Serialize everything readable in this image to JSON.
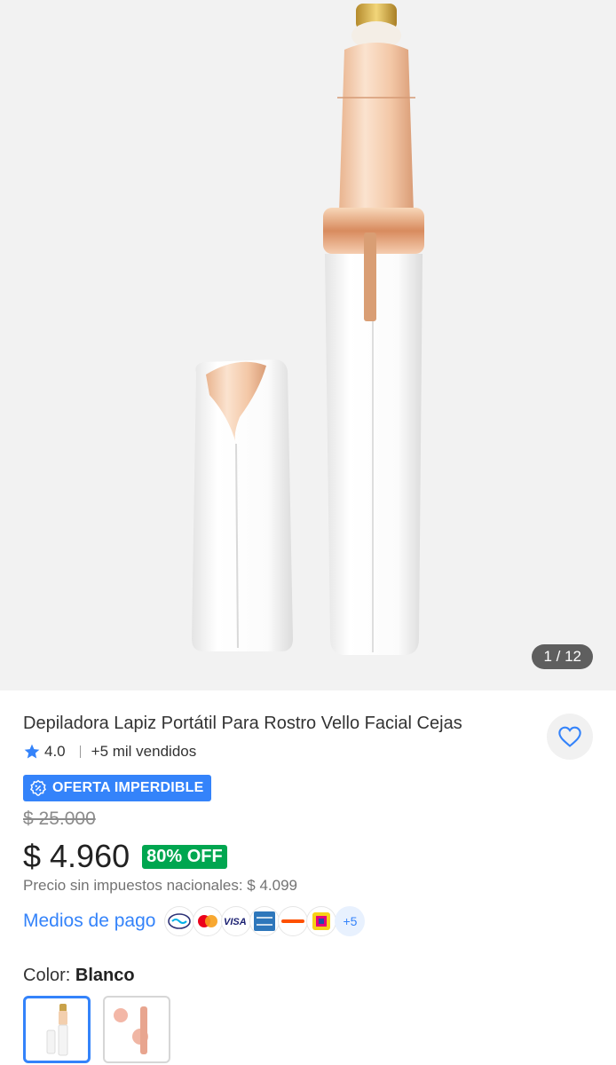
{
  "product": {
    "image_counter": "1 / 12",
    "title": "Depiladora Lapiz Portátil Para Rostro Vello Facial Cejas",
    "rating": "4.0",
    "sold": "+5 mil vendidos",
    "badge": "OFERTA IMPERDIBLE",
    "original_price": "$ 25.000",
    "price": "$ 4.960",
    "discount": "80% OFF",
    "tax_note": "Precio sin impuestos nacionales: $ 4.099"
  },
  "payment": {
    "label": "Medios de pago",
    "methods": [
      "mercado-pago-icon",
      "mastercard-icon",
      "visa-icon",
      "amex-icon",
      "naranja-x-icon",
      "pago-facil-icon"
    ],
    "more": "+5"
  },
  "variant": {
    "label": "Color:",
    "value": "Blanco"
  },
  "colors": {
    "accent": "#3483fa",
    "discount_green": "#00a650",
    "gallery_bg": "#f2f2f2"
  }
}
